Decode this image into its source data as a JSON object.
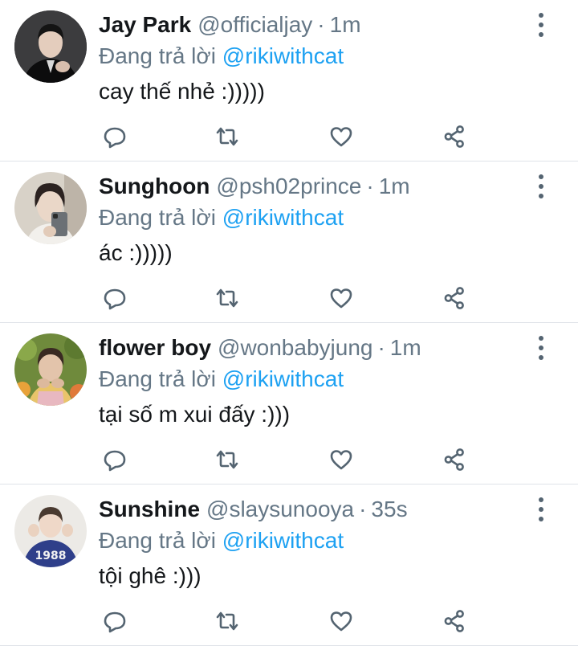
{
  "reply_prefix": "Đang trả lời",
  "tweets": [
    {
      "name": "Jay Park",
      "handle": "@officialjay",
      "separator": "·",
      "time": "1m",
      "reply_to": "@rikiwithcat",
      "text": "cay thế nhẻ :)))))"
    },
    {
      "name": "Sunghoon",
      "handle": "@psh02prince",
      "separator": "·",
      "time": "1m",
      "reply_to": "@rikiwithcat",
      "text": "ác :)))))"
    },
    {
      "name": "flower boy",
      "handle": "@wonbabyjung",
      "separator": "·",
      "time": "1m",
      "reply_to": "@rikiwithcat",
      "text": "tại số m xui đấy :)))"
    },
    {
      "name": "Sunshine",
      "handle": "@slaysunooya",
      "separator": "·",
      "time": "35s",
      "reply_to": "@rikiwithcat",
      "text": "tội ghê :)))",
      "avatar_text": "1988"
    }
  ],
  "icons": [
    "reply-icon",
    "retweet-icon",
    "like-icon",
    "share-icon",
    "more-options-icon"
  ],
  "colors": {
    "mention": "#1da1f2",
    "secondary_text": "#657786",
    "icon": "#546471",
    "divider": "#dfe3e8"
  }
}
